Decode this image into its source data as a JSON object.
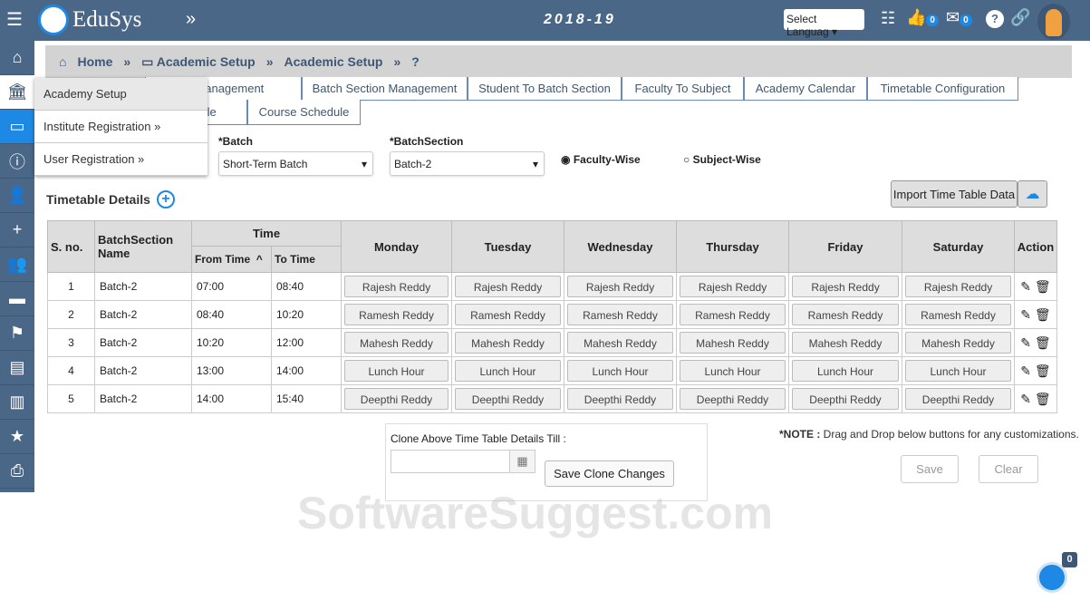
{
  "header": {
    "app_name": "EduSys",
    "expand_icon": "»",
    "year": "2018-19",
    "language": "Select Languag",
    "likes_count": "0",
    "mail_count": "0"
  },
  "sidebar": [
    "home-icon",
    "bank-icon",
    "monitor-icon",
    "info-icon",
    "user-icon",
    "add-user-icon",
    "users-icon",
    "card-icon",
    "flag-icon",
    "document-icon",
    "book-icon",
    "star-icon",
    "print-icon"
  ],
  "breadcrumb": {
    "home": "Home",
    "sep": "»",
    "item1": "Academic Setup",
    "item2": "Academic Setup",
    "help": "?"
  },
  "tabs_row1": [
    "ct Management",
    "Batch Section Management",
    "Student To Batch Section",
    "Faculty To Subject",
    "Academy Calendar",
    "Timetable Configuration"
  ],
  "tabs_row2": [
    "able",
    "Course Schedule"
  ],
  "menu": {
    "items": [
      "Academy Setup",
      "Institute Registration  »",
      "User Registration  »"
    ]
  },
  "filters": {
    "batch_label": "*Batch",
    "batch_value": "Short-Term Batch",
    "section_label": "*BatchSection",
    "section_value": "Batch-2",
    "radio1": "Faculty-Wise",
    "radio2": "Subject-Wise"
  },
  "section_title": "Timetable Details",
  "import_label": "Import Time Table Data",
  "table": {
    "headers": {
      "sno": "S. no.",
      "batch": "BatchSection Name",
      "time": "Time",
      "from": "From Time",
      "to": "To Time",
      "days": [
        "Monday",
        "Tuesday",
        "Wednesday",
        "Thursday",
        "Friday",
        "Saturday"
      ],
      "action": "Action"
    },
    "rows": [
      {
        "sno": "1",
        "batch": "Batch-2",
        "from": "07:00",
        "to": "08:40",
        "faculty": "Rajesh Reddy"
      },
      {
        "sno": "2",
        "batch": "Batch-2",
        "from": "08:40",
        "to": "10:20",
        "faculty": "Ramesh Reddy"
      },
      {
        "sno": "3",
        "batch": "Batch-2",
        "from": "10:20",
        "to": "12:00",
        "faculty": "Mahesh Reddy"
      },
      {
        "sno": "4",
        "batch": "Batch-2",
        "from": "13:00",
        "to": "14:00",
        "faculty": "Lunch Hour"
      },
      {
        "sno": "5",
        "batch": "Batch-2",
        "from": "14:00",
        "to": "15:40",
        "faculty": "Deepthi Reddy"
      }
    ]
  },
  "clone": {
    "label": "Clone Above Time Table Details Till :",
    "date_value": "",
    "button": "Save Clone Changes"
  },
  "note": {
    "bold": "*NOTE :",
    "text": " Drag and Drop below buttons for any customizations."
  },
  "save": "Save",
  "clear": "Clear",
  "watermark": "SoftwareSuggest.com",
  "chat_count": "0"
}
